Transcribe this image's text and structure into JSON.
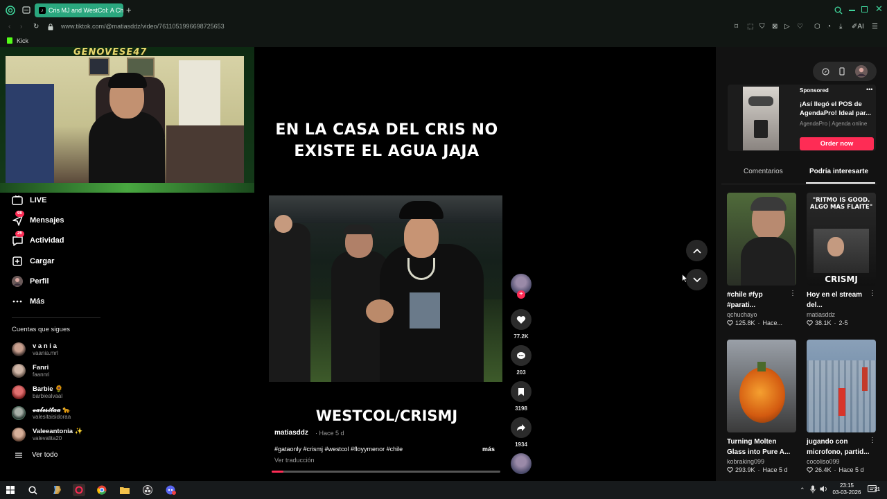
{
  "browser": {
    "tab_title": "Cris MJ and WestCol: A Ch",
    "url": "www.tiktok.com/@matiasddz/video/7611051996698725653",
    "bookmark_label": "Kick"
  },
  "webcam": {
    "overlay_name": "GENOVESE47"
  },
  "sidebar": {
    "items": [
      {
        "label": "LIVE"
      },
      {
        "label": "Mensajes",
        "badge": "98"
      },
      {
        "label": "Actividad",
        "badge": "26"
      },
      {
        "label": "Cargar"
      },
      {
        "label": "Perfil"
      },
      {
        "label": "Más"
      }
    ],
    "following_title": "Cuentas que sigues",
    "following": [
      {
        "name": "v a n i a",
        "username": "vaania.mrl"
      },
      {
        "name": "Fanri",
        "username": "faannri"
      },
      {
        "name": "Barbie 🌻",
        "username": "barbiealvaal"
      },
      {
        "name": "𝓿𝓪𝓵𝓮𝓼𝓲𝓽𝓪𝓪 🐆",
        "username": "valesitaisidoraa"
      },
      {
        "name": "Valeeantonia ✨",
        "username": "valevalita20"
      }
    ],
    "see_all": "Ver todo"
  },
  "video": {
    "overlay_caption": "EN LA CASA DEL CRIS NO EXISTE EL AGUA JAJA",
    "overlay_title": "WESTCOL/CRISMJ",
    "author": "matiasddz",
    "posted": "· Hace 5 d",
    "hashtags": "#gataonly #crismj #westcol #floyymenor #chile",
    "more": "más",
    "translate": "Ver traducción",
    "progress": 0.05
  },
  "actions": {
    "likes": "77.2K",
    "comments": "203",
    "saves": "3198",
    "shares": "1934"
  },
  "right_panel": {
    "ad": {
      "sponsored": "Sponsored",
      "title": "¡Así llegó el POS de AgendaPro! Ideal par...",
      "source": "AgendaPro | Agenda online",
      "cta": "Order now"
    },
    "tabs": [
      "Comentarios",
      "Podría interesarte"
    ],
    "cards": [
      {
        "caption": "#chile #fyp #parati...",
        "user": "qchuchayo",
        "likes": "125.8K",
        "age": "Hace..."
      },
      {
        "caption": "Hoy en el stream del...",
        "user": "matiasddz",
        "likes": "38.1K",
        "age": "2-5",
        "thumb_top": "\"RITMO IS GOOD. ALGO MAS FLAITE\"",
        "thumb_bottom": "CRISMJ"
      },
      {
        "caption": "Turning Molten Glass into Pure A...",
        "user": "kobraking099",
        "likes": "293.9K",
        "age": "Hace 5 d"
      },
      {
        "caption": "jugando con microfono, partid...",
        "user": "cocoliso099",
        "likes": "26.4K",
        "age": "Hace 5 d"
      }
    ]
  },
  "taskbar": {
    "time": "23:15",
    "date": "03-03-2026",
    "notif_count": "21"
  },
  "colors": {
    "accent": "#fe2c55",
    "tab": "#2aa77e"
  }
}
